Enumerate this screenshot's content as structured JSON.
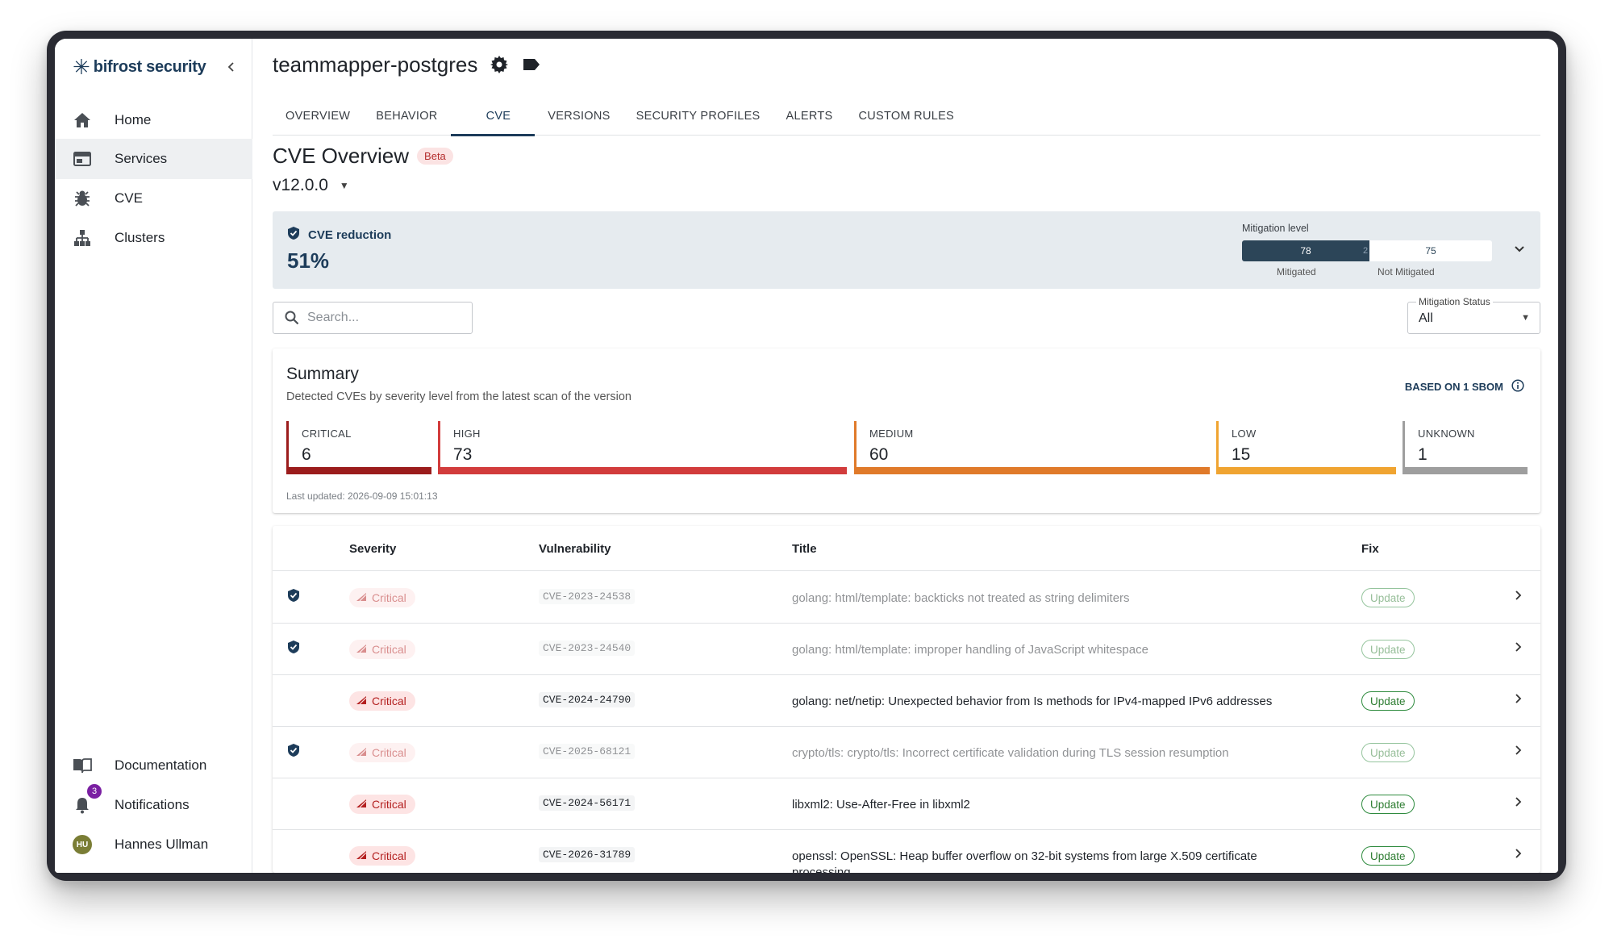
{
  "brand": {
    "name": "bifrost security",
    "accent": "#1d3c5a"
  },
  "sidebar": {
    "items": [
      {
        "label": "Home",
        "icon": "home-icon"
      },
      {
        "label": "Services",
        "icon": "services-icon",
        "active": true
      },
      {
        "label": "CVE",
        "icon": "bug-icon"
      },
      {
        "label": "Clusters",
        "icon": "clusters-icon"
      }
    ],
    "bottom": {
      "documentation": "Documentation",
      "notifications": "Notifications",
      "notifications_count": "3",
      "user_name": "Hannes Ullman",
      "user_initials": "HU"
    }
  },
  "header": {
    "title": "teammapper-postgres"
  },
  "tabs": [
    "OVERVIEW",
    "BEHAVIOR",
    "CVE",
    "VERSIONS",
    "SECURITY PROFILES",
    "ALERTS",
    "CUSTOM RULES"
  ],
  "active_tab": "CVE",
  "page": {
    "title": "CVE Overview",
    "badge": "Beta",
    "version": "v12.0.0"
  },
  "reduction": {
    "label": "CVE reduction",
    "value": "51%",
    "mitigation_title": "Mitigation level",
    "mitigated_value": "78",
    "mitigated_overflow": "2",
    "not_mitigated_value": "75",
    "mitigated_label": "Mitigated",
    "not_mitigated_label": "Not Mitigated",
    "mitigated_fraction": 0.51
  },
  "search": {
    "placeholder": "Search..."
  },
  "mitigation_filter": {
    "label": "Mitigation Status",
    "value": "All"
  },
  "summary": {
    "title": "Summary",
    "subtitle": "Detected CVEs by severity level from the latest scan of the version",
    "sbom": "BASED ON 1 SBOM",
    "last_updated": "Last updated: 2026-09-09 15:01:13",
    "severities": [
      {
        "name": "CRITICAL",
        "count": "6",
        "color": "#9b1c1c"
      },
      {
        "name": "HIGH",
        "count": "73",
        "color": "#d23c3c"
      },
      {
        "name": "MEDIUM",
        "count": "60",
        "color": "#e07a2a"
      },
      {
        "name": "LOW",
        "count": "15",
        "color": "#f0a431"
      },
      {
        "name": "UNKNOWN",
        "count": "1",
        "color": "#9e9e9e"
      }
    ]
  },
  "table": {
    "headers": {
      "severity": "Severity",
      "vulnerability": "Vulnerability",
      "title": "Title",
      "fix": "Fix"
    },
    "rows": [
      {
        "mitigated": true,
        "severity": "Critical",
        "cve": "CVE-2023-24538",
        "title": "golang: html/template: backticks not treated as string delimiters",
        "fix": "Update"
      },
      {
        "mitigated": true,
        "severity": "Critical",
        "cve": "CVE-2023-24540",
        "title": "golang: html/template: improper handling of JavaScript whitespace",
        "fix": "Update"
      },
      {
        "mitigated": false,
        "severity": "Critical",
        "cve": "CVE-2024-24790",
        "title": "golang: net/netip: Unexpected behavior from Is methods for IPv4-mapped IPv6 addresses",
        "fix": "Update"
      },
      {
        "mitigated": true,
        "severity": "Critical",
        "cve": "CVE-2025-68121",
        "title": "crypto/tls: crypto/tls: Incorrect certificate validation during TLS session resumption",
        "fix": "Update"
      },
      {
        "mitigated": false,
        "severity": "Critical",
        "cve": "CVE-2024-56171",
        "title": "libxml2: Use-After-Free in libxml2",
        "fix": "Update"
      },
      {
        "mitigated": false,
        "severity": "Critical",
        "cve": "CVE-2026-31789",
        "title": "openssl: OpenSSL: Heap buffer overflow on 32-bit systems from large X.509 certificate processing",
        "fix": "Update"
      }
    ]
  }
}
